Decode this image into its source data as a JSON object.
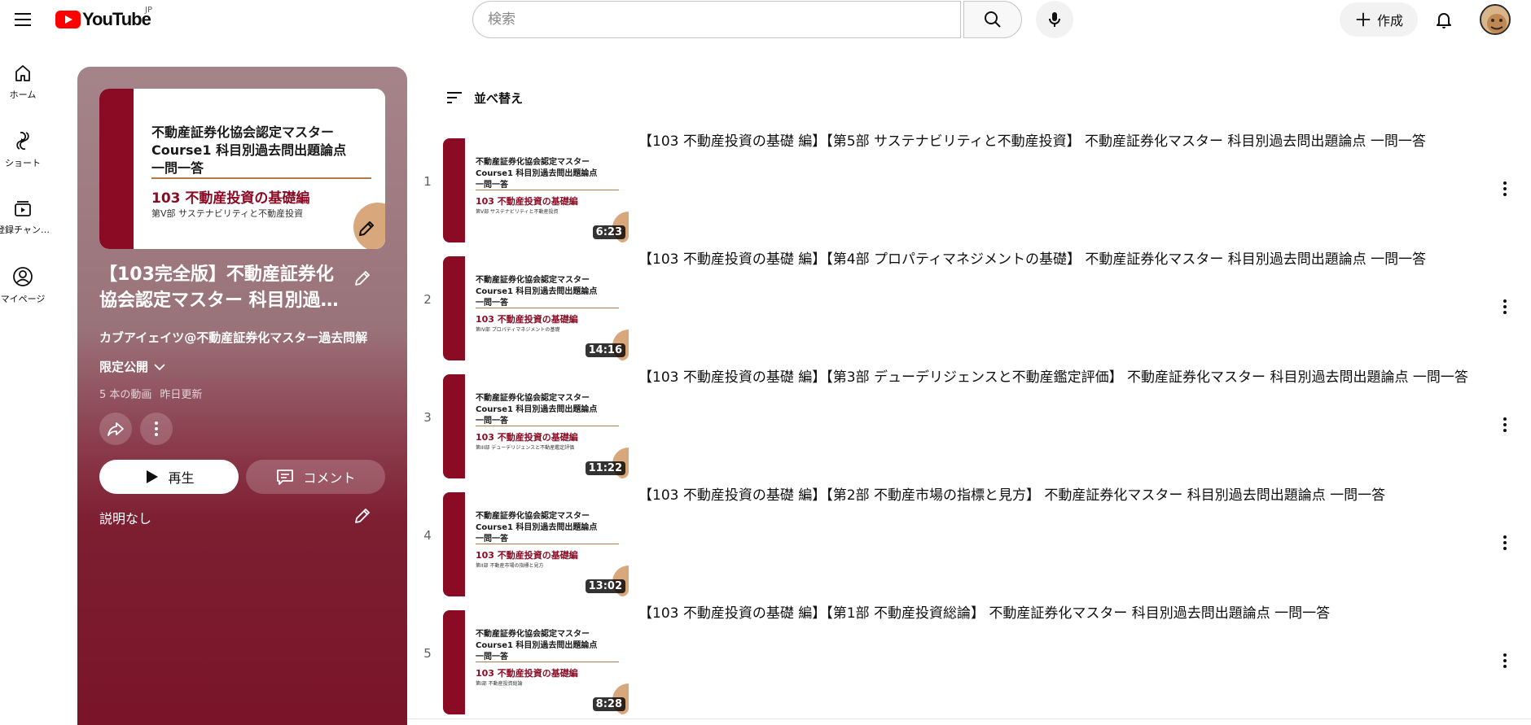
{
  "masthead": {
    "logo_text": "YouTube",
    "region": "JP",
    "search_placeholder": "検索",
    "create_label": "作成"
  },
  "guide": [
    {
      "label": "ホーム",
      "icon": "home-icon"
    },
    {
      "label": "ショート",
      "icon": "shorts-icon"
    },
    {
      "label": "登録チャン…",
      "icon": "subscriptions-icon"
    },
    {
      "label": "マイページ",
      "icon": "you-icon"
    }
  ],
  "playlist": {
    "title": "【103完全版】不動産証券化協会認定マスター 科目別過…",
    "channel": "カブアイェイツ@不動産証券化マスター過去問解",
    "privacy": "限定公開",
    "video_count": "5 本の動画",
    "updated": "昨日更新",
    "play_label": "再生",
    "comment_label": "コメント",
    "description": "説明なし",
    "thumbnail": {
      "line1": "不動産証券化協会認定マスター",
      "line2": "Course1 科目別過去問出題論点",
      "line3": "一問一答",
      "heading": "103 不動産投資の基礎編",
      "sub": "第V部 サステナビリティと不動産投資"
    }
  },
  "sort_label": "並べ替え",
  "thumbnail_common": {
    "line1": "不動産証券化協会認定マスター",
    "line2": "Course1 科目別過去問出題論点",
    "line3": "一問一答",
    "heading": "103 不動産投資の基礎編"
  },
  "videos": [
    {
      "index": "1",
      "title": "【103 不動産投資の基礎 編】【第5部 サステナビリティと不動産投資】 不動産証券化マスター 科目別過去問出題論点 一問一答",
      "duration": "6:23",
      "thumb_sub": "第V部 サステナビリティと不動産投資"
    },
    {
      "index": "2",
      "title": "【103 不動産投資の基礎 編】【第4部 プロパティマネジメントの基礎】 不動産証券化マスター 科目別過去問出題論点 一問一答",
      "duration": "14:16",
      "thumb_sub": "第IV部 プロパティマネジメントの基礎"
    },
    {
      "index": "3",
      "title": "【103 不動産投資の基礎 編】【第3部 デューデリジェンスと不動産鑑定評価】 不動産証券化マスター 科目別過去問出題論点 一問一答",
      "duration": "11:22",
      "thumb_sub": "第III部 デューデリジェンスと不動産鑑定評価"
    },
    {
      "index": "4",
      "title": "【103 不動産投資の基礎 編】【第2部 不動産市場の指標と見方】 不動産証券化マスター 科目別過去問出題論点 一問一答",
      "duration": "13:02",
      "thumb_sub": "第II部 不動産市場の指標と見方"
    },
    {
      "index": "5",
      "title": "【103 不動産投資の基礎 編】【第1部 不動産投資総論】 不動産証券化マスター 科目別過去問出題論点 一問一答",
      "duration": "8:28",
      "thumb_sub": "第I部 不動産投資総論"
    }
  ],
  "colors": {
    "brand_red": "#ff0000",
    "thumb_accent": "#8b0b24",
    "panel_bottom": "#7a1428"
  }
}
